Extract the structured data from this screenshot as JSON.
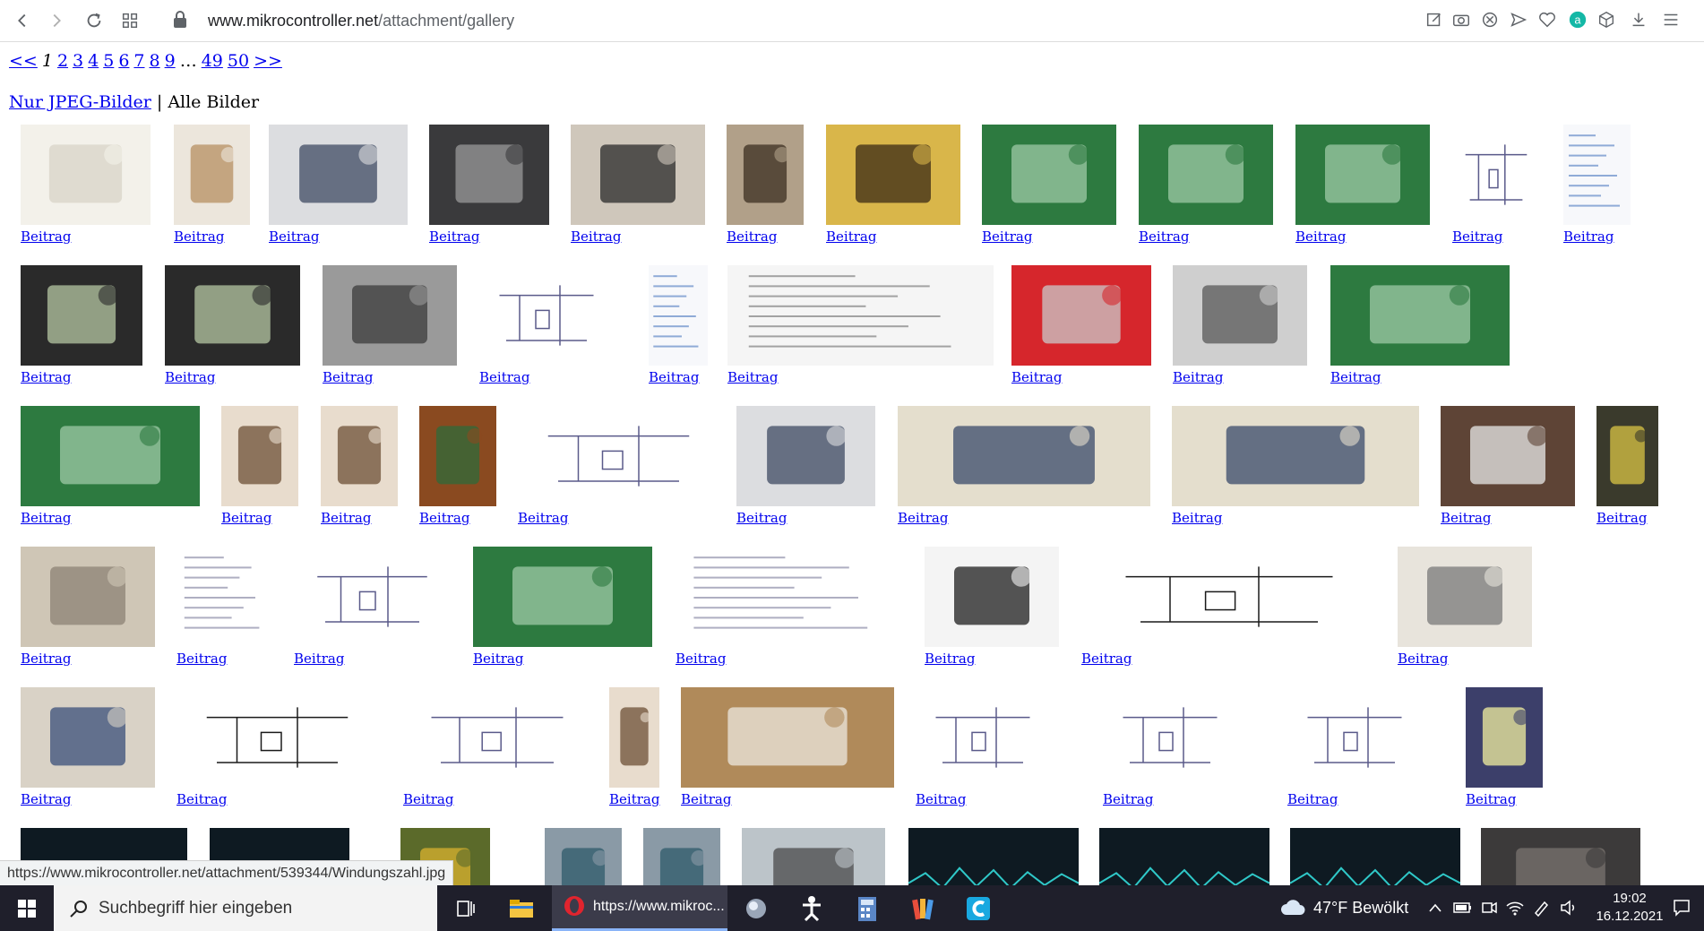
{
  "browser": {
    "url_host": "www.mikrocontroller.net",
    "url_path": "/attachment/gallery"
  },
  "pager": {
    "prev": "<<",
    "current": "1",
    "pages": [
      "2",
      "3",
      "4",
      "5",
      "6",
      "7",
      "8",
      "9"
    ],
    "ellipsis": "…",
    "last_pages": [
      "49",
      "50"
    ],
    "next": ">>"
  },
  "filter": {
    "jpeg_link": "Nur JPEG-Bilder",
    "separator": "|",
    "all_label": "Alle Bilder"
  },
  "caption": "Beitrag",
  "thumbnails": [
    [
      "photo-oscillograph-label",
      "photo-boxes",
      "photo-bag",
      "photo-chip",
      "photo-timer-display",
      "photo-drill",
      "photo-transformer",
      "photo-pcb-green",
      "photo-pcb-green",
      "photo-pcb-green",
      "schematic",
      "screenshot"
    ],
    [
      "photo-handheld-device",
      "photo-handheld-device",
      "photo-capacitor",
      "schematic",
      "screenshot",
      "screenshot-webshop",
      "photo-red-board",
      "photo-fan",
      "photo-pcb-green"
    ],
    [
      "photo-pcb-green",
      "photo-hand-board",
      "photo-hand-board",
      "photo-pcb-orange",
      "schematic",
      "photo-bag",
      "photo-device-beige",
      "photo-device-beige",
      "photo-lamp",
      "photo-misc"
    ],
    [
      "photo-lamp-parts",
      "screenshot-table",
      "schematic",
      "photo-pcb-green",
      "screenshot-table",
      "photo-rack-device",
      "schematic-pcb-layout",
      "photo-stove"
    ],
    [
      "photo-electronics-box",
      "schematic-pcb-layout",
      "schematic",
      "photo-hand-board",
      "photo-paper-schematic",
      "schematic",
      "schematic",
      "schematic",
      "photo-lamp-yellow"
    ],
    [
      "screenshot-oscilloscope",
      "screenshot-oscilloscope",
      "photo-pcb-yellow",
      "photo-hands",
      "photo-hands",
      "photo-workshop",
      "screenshot-oscilloscope",
      "screenshot-oscilloscope",
      "screenshot-oscilloscope",
      "photo-floor"
    ]
  ],
  "status_url": "https://www.mikrocontroller.net/attachment/539344/Windungszahl.jpg",
  "taskbar": {
    "search_placeholder": "Suchbegriff hier eingeben",
    "active_window": "https://www.mikroc...",
    "weather": "47°F Bewölkt",
    "time": "19:02",
    "date": "16.12.2021"
  }
}
